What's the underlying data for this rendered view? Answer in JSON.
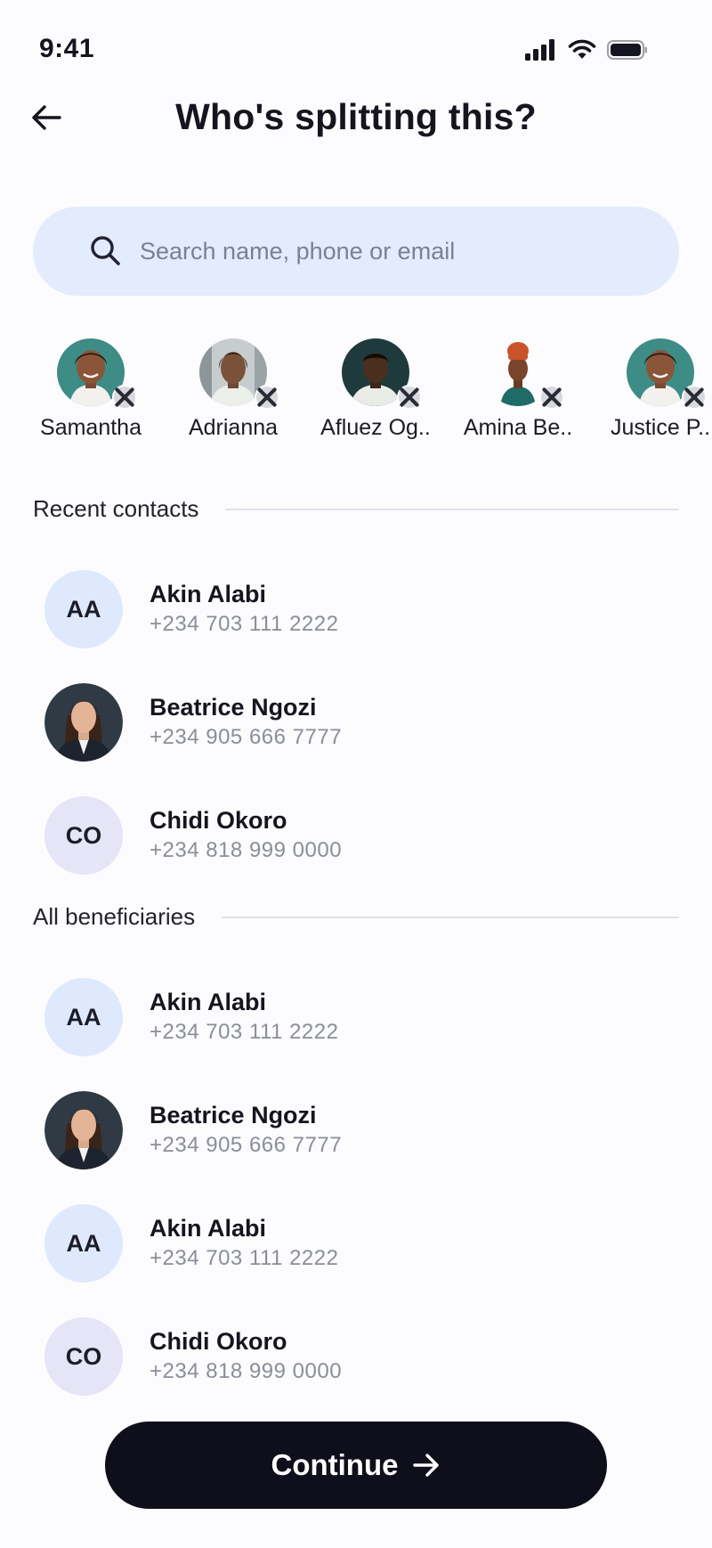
{
  "status_bar": {
    "time": "9:41"
  },
  "header": {
    "title": "Who's splitting this?"
  },
  "search": {
    "placeholder": "Search name, phone or email",
    "value": ""
  },
  "selected": [
    {
      "name": "Samantha"
    },
    {
      "name": "Adrianna"
    },
    {
      "name": "Afluez Og.."
    },
    {
      "name": "Amina Be.."
    },
    {
      "name": "Justice P.."
    }
  ],
  "recent": {
    "title": "Recent contacts",
    "items": [
      {
        "initials": "AA",
        "name": "Akin Alabi",
        "phone": "+234 703 111 2222"
      },
      {
        "initials": "",
        "name": "Beatrice Ngozi",
        "phone": "+234 905 666 7777"
      },
      {
        "initials": "CO",
        "name": "Chidi Okoro",
        "phone": "+234 818 999 0000"
      }
    ]
  },
  "beneficiaries": {
    "title": "All beneficiaries",
    "items": [
      {
        "initials": "AA",
        "name": "Akin Alabi",
        "phone": "+234 703 111 2222"
      },
      {
        "initials": "",
        "name": "Beatrice Ngozi",
        "phone": "+234 905 666 7777"
      },
      {
        "initials": "AA",
        "name": "Akin Alabi",
        "phone": "+234 703 111 2222"
      },
      {
        "initials": "CO",
        "name": "Chidi Okoro",
        "phone": "+234 818 999 0000"
      }
    ]
  },
  "footer": {
    "continue_label": "Continue"
  },
  "colors": {
    "accent": "#0f0f1c",
    "search_bg": "#e3ebfd",
    "avatar_blue": "#dfe9fd",
    "avatar_lavender": "#e6e4f7",
    "muted_text": "#8a8e99"
  }
}
